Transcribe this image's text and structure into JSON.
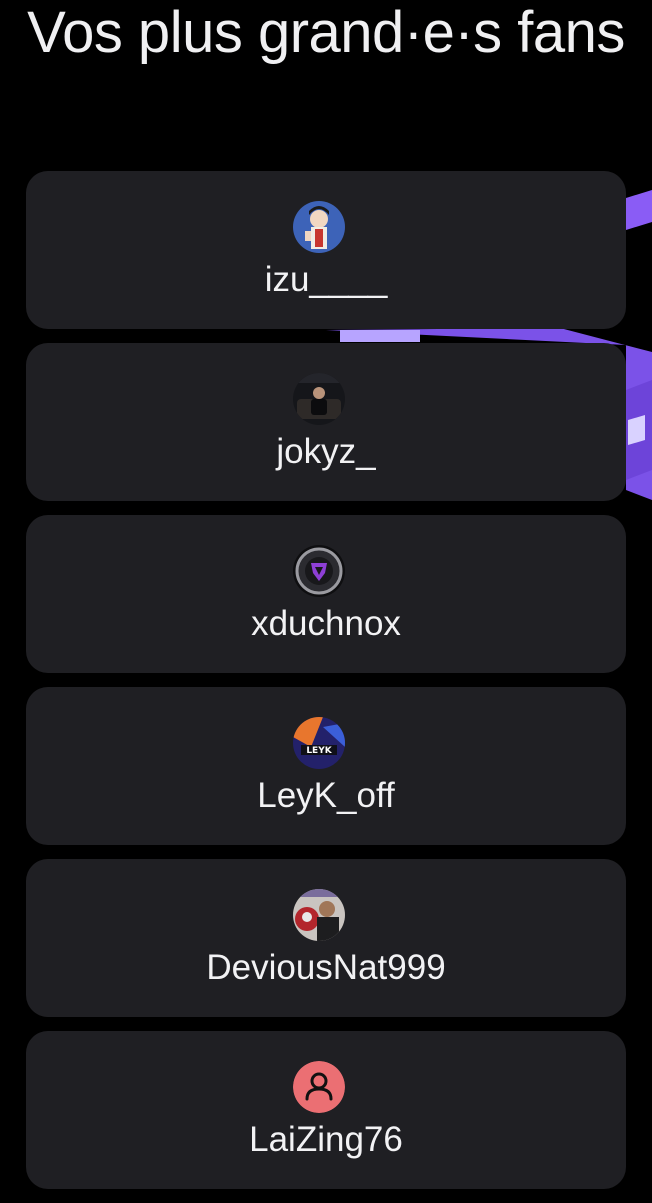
{
  "page": {
    "title": "Vos plus grand·e·s fans"
  },
  "colors": {
    "background": "#000000",
    "card": "#1f1f23",
    "text": "#f2f2f4",
    "accent_purple": "#8a5cf5",
    "default_avatar": "#eb6f73"
  },
  "fans": [
    {
      "username": "izu____",
      "avatar": "anime-character-avatar"
    },
    {
      "username": "jokyz_",
      "avatar": "person-on-couch-avatar"
    },
    {
      "username": "xduchnox",
      "avatar": "decepticon-logo-avatar"
    },
    {
      "username": "LeyK_off",
      "avatar": "leyk-logo-avatar"
    },
    {
      "username": "DeviousNat999",
      "avatar": "photo-with-deadpool-avatar"
    },
    {
      "username": "LaiZing76",
      "avatar": "default-user-icon"
    }
  ]
}
